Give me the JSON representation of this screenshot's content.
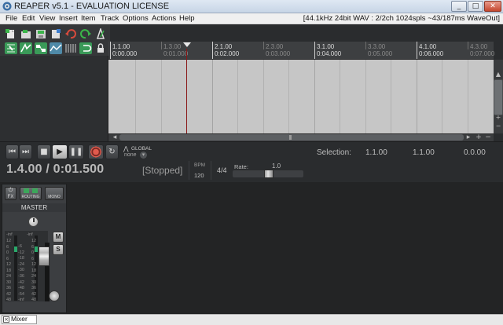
{
  "window": {
    "title": "REAPER v5.1 - EVALUATION LICENSE",
    "minimize": "_",
    "maximize": "□",
    "close": "✕"
  },
  "menu": {
    "items": [
      "File",
      "Edit",
      "View",
      "Insert",
      "Item",
      "Track",
      "Options",
      "Actions",
      "Help"
    ],
    "status": "[44.1kHz 24bit WAV : 2/2ch 1024spls ~43/187ms WaveOut]"
  },
  "ruler": {
    "marks": [
      {
        "top": "1.1.00",
        "bottom": "0:00.000",
        "major": true
      },
      {
        "top": "1.3.00",
        "bottom": "0:01.000",
        "major": false
      },
      {
        "top": "2.1.00",
        "bottom": "0:02.000",
        "major": true
      },
      {
        "top": "2.3.00",
        "bottom": "0:03.000",
        "major": false
      },
      {
        "top": "3.1.00",
        "bottom": "0:04.000",
        "major": true
      },
      {
        "top": "3.3.00",
        "bottom": "0:05.000",
        "major": false
      },
      {
        "top": "4.1.00",
        "bottom": "0:06.000",
        "major": true
      },
      {
        "top": "4.3.00",
        "bottom": "0:07.000",
        "major": false
      }
    ]
  },
  "transport": {
    "global_label": "GLOBAL",
    "global_value": "none",
    "selection_label": "Selection:",
    "selection_start": "1.1.00",
    "selection_end": "1.1.00",
    "selection_length": "0.0.00",
    "time": "1.4.00 / 0:01.500",
    "state": "[Stopped]",
    "bpm_label": "BPM",
    "bpm": "120",
    "time_signature": "4/4",
    "rate_label": "Rate:",
    "rate_value": "1.0"
  },
  "mixer": {
    "fx_label": "FX",
    "routing_label": "ROUTING",
    "mono_label": "MONO",
    "track_name": "MASTER",
    "meter_left_top": "-inf",
    "meter_right_top": "-inf",
    "mute": "M",
    "solo": "S",
    "scale_left": [
      "12",
      "6",
      "0",
      "6",
      "12",
      "18",
      "24",
      "30",
      "36",
      "42",
      "48"
    ],
    "scale_mid": [
      "-6",
      "-12",
      "-18",
      "-24",
      "-30",
      "-36",
      "-42",
      "-48",
      "-54",
      "-inf"
    ],
    "scale_right": [
      "12",
      "6",
      "0",
      "6",
      "12",
      "18",
      "24",
      "30",
      "36",
      "42",
      "48"
    ],
    "meter_level_left": 0.08,
    "meter_level_right": 0.08
  },
  "docker": {
    "tab_label": "Mixer"
  },
  "colors": {
    "accent_record": "#e05a4d",
    "meter_green": "#2aa86a",
    "arrange_bg": "#c6c6c6",
    "cursor": "#8a1717"
  }
}
